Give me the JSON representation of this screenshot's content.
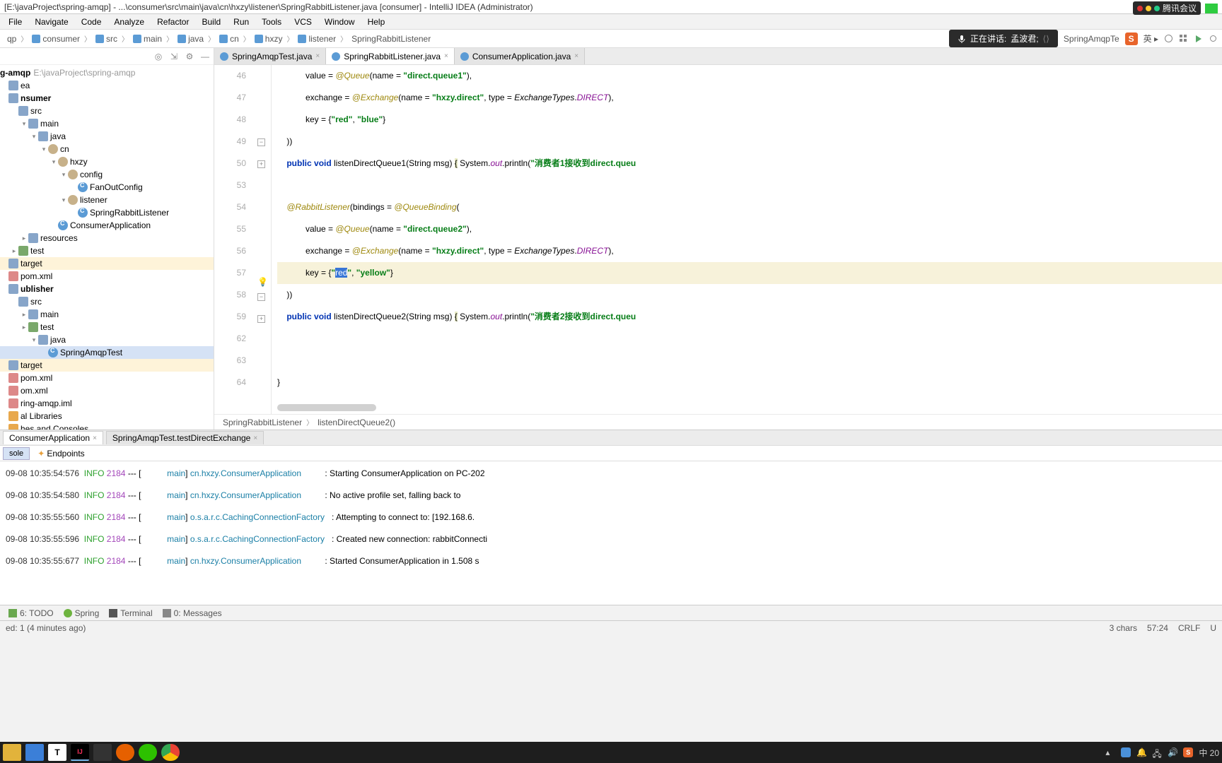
{
  "title": "[E:\\javaProject\\spring-amqp] - ...\\consumer\\src\\main\\java\\cn\\hxzy\\listener\\SpringRabbitListener.java [consumer] - IntelliJ IDEA (Administrator)",
  "tencent_label": "腾讯会议",
  "menu": [
    "File",
    "Navigate",
    "Code",
    "Analyze",
    "Refactor",
    "Build",
    "Run",
    "Tools",
    "VCS",
    "Window",
    "Help"
  ],
  "breadcrumb": [
    "qp",
    "consumer",
    "src",
    "main",
    "java",
    "cn",
    "hxzy",
    "listener",
    "SpringRabbitListener"
  ],
  "speech": {
    "prefix": "正在讲话:",
    "speaker": "孟波君;"
  },
  "nav_tab_label": "SpringAmqpTe",
  "tree": {
    "root": "g-amqp",
    "root_path": "E:\\javaProject\\spring-amqp",
    "items": [
      {
        "ind": 0,
        "arrow": "",
        "icon": "folder",
        "label": "ea"
      },
      {
        "ind": 0,
        "arrow": "",
        "icon": "folder",
        "label": "nsumer",
        "bold": true
      },
      {
        "ind": 1,
        "arrow": "",
        "icon": "folder",
        "label": "src"
      },
      {
        "ind": 2,
        "arrow": "▾",
        "icon": "folder",
        "label": "main"
      },
      {
        "ind": 3,
        "arrow": "▾",
        "icon": "folder",
        "label": "java"
      },
      {
        "ind": 4,
        "arrow": "▾",
        "icon": "pkg",
        "label": "cn"
      },
      {
        "ind": 5,
        "arrow": "▾",
        "icon": "pkg",
        "label": "hxzy"
      },
      {
        "ind": 6,
        "arrow": "▾",
        "icon": "pkg",
        "label": "config"
      },
      {
        "ind": 7,
        "arrow": "",
        "icon": "java",
        "label": "FanOutConfig"
      },
      {
        "ind": 6,
        "arrow": "▾",
        "icon": "pkg",
        "label": "listener"
      },
      {
        "ind": 7,
        "arrow": "",
        "icon": "java",
        "label": "SpringRabbitListener"
      },
      {
        "ind": 5,
        "arrow": "",
        "icon": "java",
        "label": "ConsumerApplication"
      },
      {
        "ind": 2,
        "arrow": "▸",
        "icon": "folder",
        "label": "resources"
      },
      {
        "ind": 1,
        "arrow": "▸",
        "icon": "test",
        "label": "test"
      },
      {
        "ind": 0,
        "arrow": "",
        "icon": "folder",
        "label": "target",
        "special": true
      },
      {
        "ind": 0,
        "arrow": "",
        "icon": "xml",
        "label": "pom.xml"
      },
      {
        "ind": 0,
        "arrow": "",
        "icon": "folder",
        "label": "ublisher",
        "bold": true
      },
      {
        "ind": 1,
        "arrow": "",
        "icon": "folder",
        "label": "src"
      },
      {
        "ind": 2,
        "arrow": "▸",
        "icon": "folder",
        "label": "main"
      },
      {
        "ind": 2,
        "arrow": "▸",
        "icon": "test",
        "label": "test"
      },
      {
        "ind": 3,
        "arrow": "▾",
        "icon": "folder",
        "label": "java"
      },
      {
        "ind": 4,
        "arrow": "",
        "icon": "java",
        "label": "SpringAmqpTest",
        "selected": true
      },
      {
        "ind": 0,
        "arrow": "",
        "icon": "folder",
        "label": "target",
        "special": true
      },
      {
        "ind": 0,
        "arrow": "",
        "icon": "xml",
        "label": "pom.xml"
      },
      {
        "ind": 0,
        "arrow": "",
        "icon": "xml",
        "label": "om.xml"
      },
      {
        "ind": 0,
        "arrow": "",
        "icon": "xml",
        "label": "ring-amqp.iml"
      },
      {
        "ind": 0,
        "arrow": "",
        "icon": "lib",
        "label": "al Libraries"
      },
      {
        "ind": 0,
        "arrow": "",
        "icon": "lib",
        "label": "hes and Consoles"
      }
    ]
  },
  "editor_tabs": [
    {
      "label": "SpringAmqpTest.java",
      "active": false
    },
    {
      "label": "SpringRabbitListener.java",
      "active": true
    },
    {
      "label": "ConsumerApplication.java",
      "active": false
    }
  ],
  "gutter": [
    "46",
    "47",
    "48",
    "49",
    "50",
    "53",
    "54",
    "55",
    "56",
    "57",
    "58",
    "59",
    "62",
    "63",
    "64"
  ],
  "code_crumb": [
    "SpringRabbitListener",
    "listenDirectQueue2()"
  ],
  "run_tabs": [
    {
      "label": "ConsumerApplication",
      "closable": true
    },
    {
      "label": "SpringAmqpTest.testDirectExchange",
      "closable": true
    }
  ],
  "sub_tabs": [
    "sole",
    "Endpoints"
  ],
  "console": [
    {
      "ts": "09-08 10:35:54:576",
      "lvl": "INFO",
      "pid": "2184",
      "thread": "main",
      "logger": "cn.hxzy.ConsumerApplication",
      "msg": ": Starting ConsumerApplication on PC-202"
    },
    {
      "ts": "09-08 10:35:54:580",
      "lvl": "INFO",
      "pid": "2184",
      "thread": "main",
      "logger": "cn.hxzy.ConsumerApplication",
      "msg": ": No active profile set, falling back to"
    },
    {
      "ts": "09-08 10:35:55:560",
      "lvl": "INFO",
      "pid": "2184",
      "thread": "main",
      "logger": "o.s.a.r.c.CachingConnectionFactory",
      "msg": ": Attempting to connect to: [192.168.6."
    },
    {
      "ts": "09-08 10:35:55:596",
      "lvl": "INFO",
      "pid": "2184",
      "thread": "main",
      "logger": "o.s.a.r.c.CachingConnectionFactory",
      "msg": ": Created new connection: rabbitConnecti"
    },
    {
      "ts": "09-08 10:35:55:677",
      "lvl": "INFO",
      "pid": "2184",
      "thread": "main",
      "logger": "cn.hxzy.ConsumerApplication",
      "msg": ": Started ConsumerApplication in 1.508 s"
    }
  ],
  "tool_strip": [
    "6: TODO",
    "Spring",
    "Terminal",
    "0: Messages"
  ],
  "status": {
    "left": "ed: 1 (4 minutes ago)",
    "right": [
      "3 chars",
      "57:24",
      "CRLF",
      "U"
    ]
  },
  "tray_text": "中  20"
}
